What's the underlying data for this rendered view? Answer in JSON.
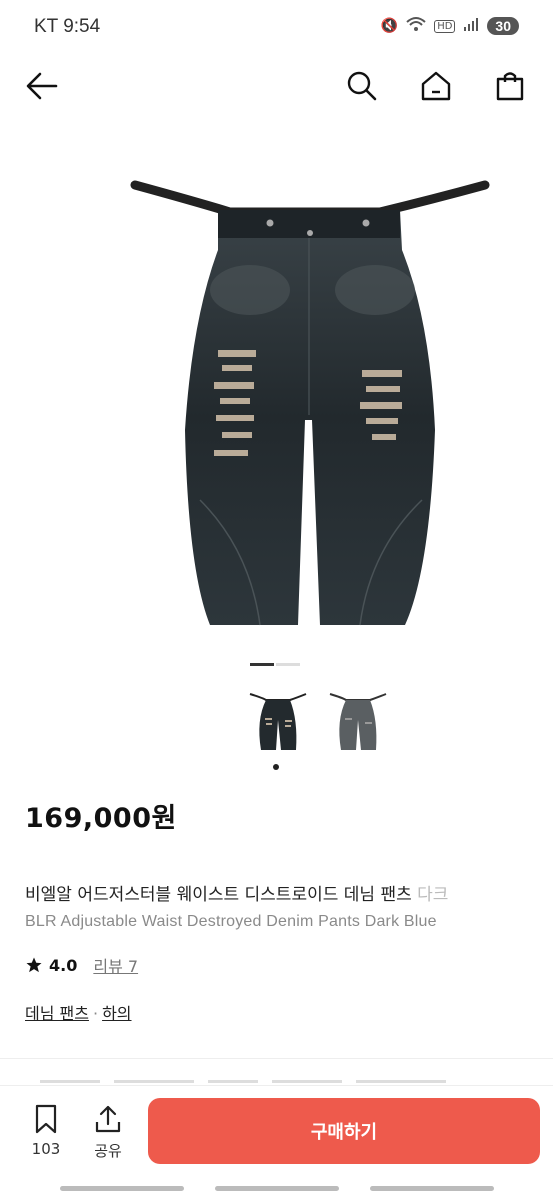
{
  "status": {
    "carrier_time": "KT 9:54",
    "battery": "30"
  },
  "product": {
    "price": "169,000원",
    "title_ko": "비엘알 어드저스터블 웨이스트 디스트로이드 데님 팬츠 ",
    "title_ko_overflow": "다크",
    "title_en": "BLR Adjustable Waist Destroyed Denim Pants Dark Blue",
    "rating": "4.0",
    "review_label": "리뷰 7",
    "category": "데님 팬츠",
    "category_parent": "하의"
  },
  "bottom": {
    "wish_count": "103",
    "share_label": "공유",
    "buy_label": "구매하기"
  },
  "icons": [
    "back-arrow-icon",
    "search-icon",
    "home-icon",
    "shopping-bag-icon",
    "star-icon",
    "bookmark-icon",
    "share-icon"
  ],
  "colors": {
    "buy_button": "#ee5a4c"
  }
}
